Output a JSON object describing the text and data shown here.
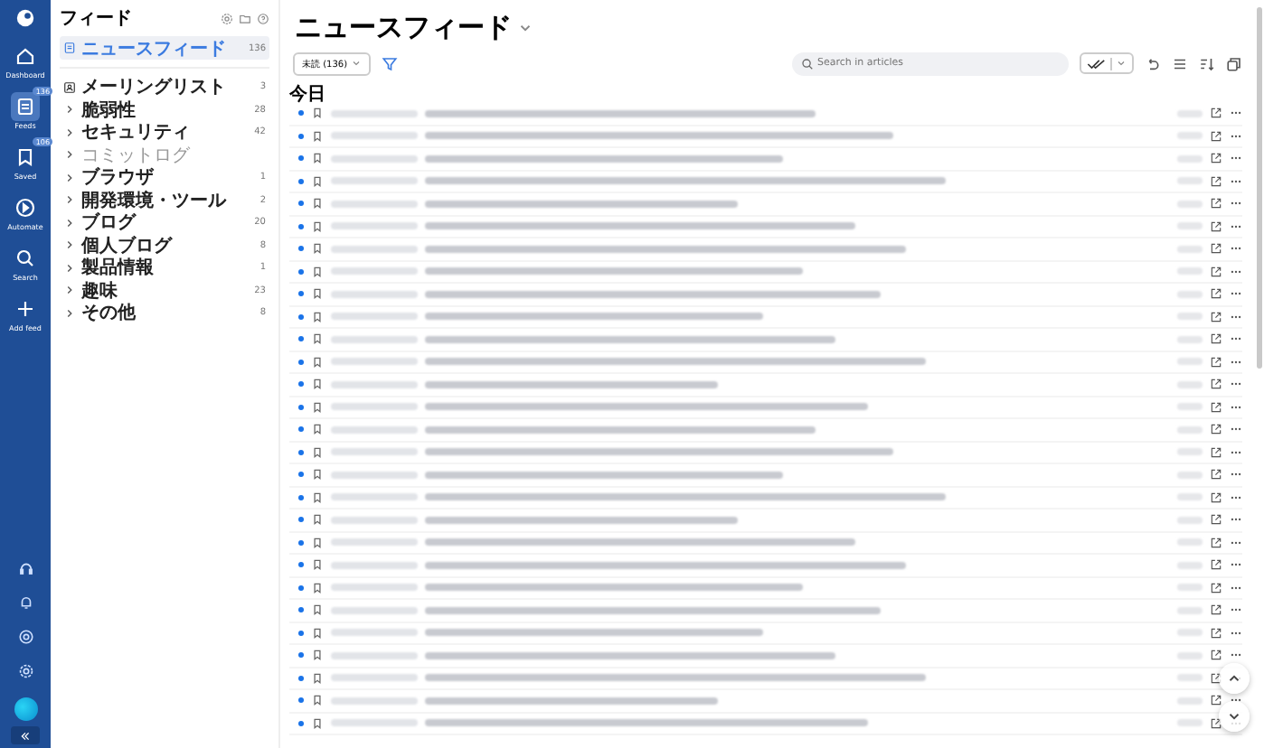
{
  "nav": {
    "items": [
      {
        "kind": "dashboard",
        "label": "Dashboard",
        "selected": false
      },
      {
        "kind": "feeds",
        "label": "Feeds",
        "selected": true,
        "badge": "136"
      },
      {
        "kind": "saved",
        "label": "Saved",
        "selected": false,
        "badge": "106"
      },
      {
        "kind": "automate",
        "label": "Automate",
        "selected": false
      },
      {
        "kind": "search",
        "label": "Search",
        "selected": false
      },
      {
        "kind": "add",
        "label": "Add feed",
        "selected": false
      }
    ]
  },
  "sidebar": {
    "title": "フィード",
    "items": [
      {
        "kind": "feed",
        "label": "ニュースフィード",
        "count": "136",
        "selected": true,
        "disabled": false
      },
      {
        "kind": "mail",
        "label": "メーリングリスト",
        "count": "3",
        "selected": false,
        "disabled": false
      },
      {
        "kind": "folder",
        "label": "脆弱性",
        "count": "28",
        "selected": false,
        "disabled": false
      },
      {
        "kind": "folder",
        "label": "セキュリティ",
        "count": "42",
        "selected": false,
        "disabled": false
      },
      {
        "kind": "folder",
        "label": "コミットログ",
        "selected": false,
        "disabled": true
      },
      {
        "kind": "folder",
        "label": "ブラウザ",
        "count": "1",
        "selected": false,
        "disabled": false
      },
      {
        "kind": "folder",
        "label": "開発環境・ツール",
        "count": "2",
        "selected": false,
        "disabled": false
      },
      {
        "kind": "folder",
        "label": "ブログ",
        "count": "20",
        "selected": false,
        "disabled": false
      },
      {
        "kind": "folder",
        "label": "個人ブログ",
        "count": "8",
        "selected": false,
        "disabled": false
      },
      {
        "kind": "folder",
        "label": "製品情報",
        "count": "1",
        "selected": false,
        "disabled": false
      },
      {
        "kind": "folder",
        "label": "趣味",
        "count": "23",
        "selected": false,
        "disabled": false
      },
      {
        "kind": "folder",
        "label": "その他",
        "count": "8",
        "selected": false,
        "disabled": false
      }
    ]
  },
  "main": {
    "title": "ニュースフィード",
    "filter": "未読 (136)",
    "search": {
      "placeholder": "Search in articles"
    },
    "section": "今日",
    "rows": [
      {
        "unread": true
      },
      {
        "unread": true
      },
      {
        "unread": true
      },
      {
        "unread": true
      },
      {
        "unread": true
      },
      {
        "unread": true
      },
      {
        "unread": true
      },
      {
        "unread": true
      },
      {
        "unread": true
      },
      {
        "unread": true
      },
      {
        "unread": true
      },
      {
        "unread": true
      },
      {
        "unread": true
      },
      {
        "unread": true
      },
      {
        "unread": true
      },
      {
        "unread": true
      },
      {
        "unread": true
      },
      {
        "unread": true
      },
      {
        "unread": true
      },
      {
        "unread": true
      },
      {
        "unread": true
      },
      {
        "unread": true
      },
      {
        "unread": true
      },
      {
        "unread": true
      },
      {
        "unread": true
      },
      {
        "unread": true
      },
      {
        "unread": true
      },
      {
        "unread": true
      }
    ]
  }
}
